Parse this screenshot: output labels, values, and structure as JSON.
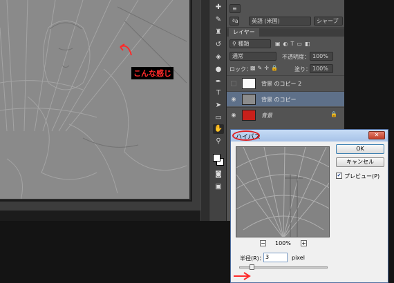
{
  "annotation": {
    "text": "こんな感じ"
  },
  "char_panel": {
    "font_family": "英語 (米国)",
    "anti_alias": "シャープ"
  },
  "layers_panel": {
    "tab_label": "レイヤー",
    "filter_label": "種類",
    "blend_mode": "通常",
    "opacity_label": "不透明度：",
    "opacity_value": "100%",
    "lock_label": "ロック：",
    "fill_label": "塗り：",
    "fill_value": "100%",
    "layers": [
      {
        "name": "背景 のコピー 2",
        "visible": false,
        "selected": false
      },
      {
        "name": "背景 のコピー",
        "visible": true,
        "selected": true
      },
      {
        "name": "背景",
        "visible": true,
        "selected": false,
        "locked": true
      }
    ]
  },
  "dialog": {
    "title": "ハイパス",
    "close_label": "✕",
    "ok_label": "OK",
    "cancel_label": "キャンセル",
    "preview_label": "プレビュー(P)",
    "preview_checked": true,
    "zoom_out": "−",
    "zoom_in": "+",
    "zoom_value": "100%",
    "radius_label": "半径(R)：",
    "radius_value": "3",
    "radius_unit": "pixel"
  },
  "colors": {
    "annotation": "#ff2a2a",
    "selected_layer": "#5e7089",
    "panel_bg": "#535353"
  }
}
